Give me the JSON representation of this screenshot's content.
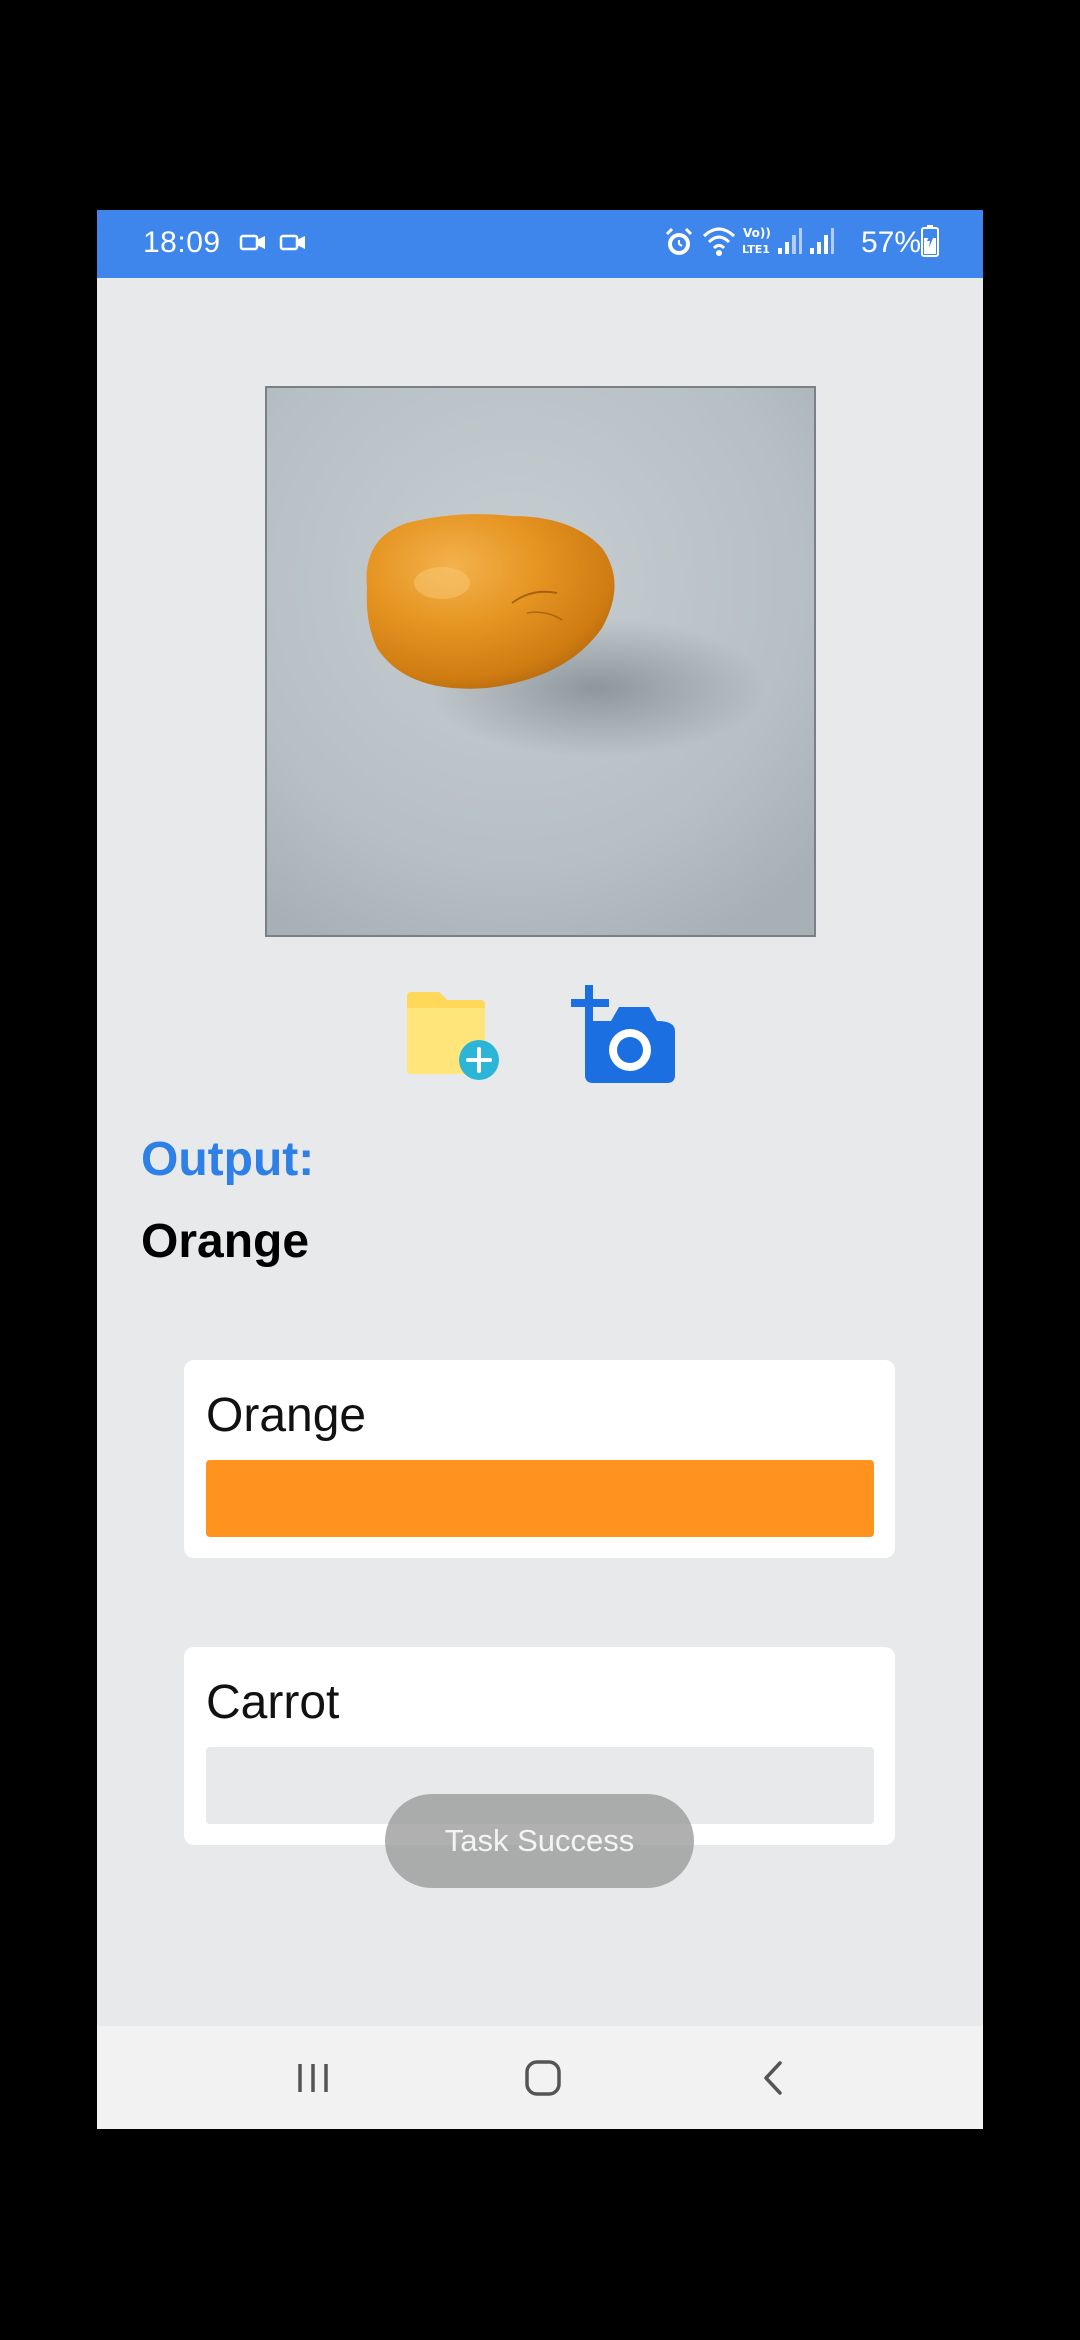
{
  "status_bar": {
    "time": "18:09",
    "battery": "57%",
    "icons": [
      "video-camera-icon",
      "video-camera-icon",
      "alarm-icon",
      "wifi-icon",
      "volte-icon",
      "signal-icon",
      "signal-icon",
      "battery-icon"
    ]
  },
  "preview": {
    "alt": "Photo of an orange"
  },
  "actions": {
    "gallery_icon": "folder-add-icon",
    "camera_icon": "add-camera-icon"
  },
  "output": {
    "label": "Output:",
    "value": "Orange"
  },
  "results": [
    {
      "label": "Orange",
      "confidence": 1.0,
      "color": "#FF931E"
    },
    {
      "label": "Carrot",
      "confidence": 0.0,
      "color": "#FF931E"
    }
  ],
  "toast": "Task Success",
  "colors": {
    "accent": "#3F86EC",
    "output_label": "#2F80E6",
    "bar": "#FF931E",
    "background": "#E8E9EB"
  }
}
